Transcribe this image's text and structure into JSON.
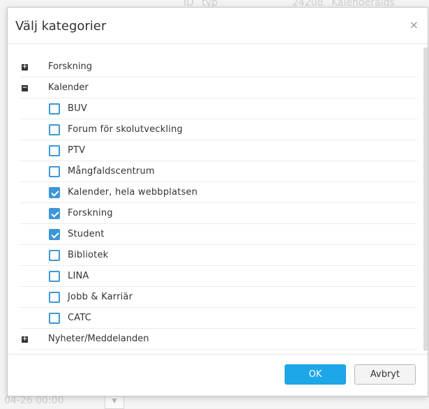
{
  "background": {
    "id_text": "ID _typ",
    "right_text": "24208 _Kalenderalds",
    "date_text": "04-26 00:00",
    "dropdown_icon": "chevron-down-icon"
  },
  "dialog": {
    "title": "Välj kategorier",
    "close_label": "×",
    "categories": [
      {
        "label": "Forskning",
        "expander": "+",
        "children": []
      },
      {
        "label": "Kalender",
        "expander": "−",
        "children": [
          {
            "label": "BUV",
            "checked": false
          },
          {
            "label": "Forum för skolutveckling",
            "checked": false
          },
          {
            "label": "PTV",
            "checked": false
          },
          {
            "label": "Mångfaldscentrum",
            "checked": false
          },
          {
            "label": "Kalender, hela webbplatsen",
            "checked": true
          },
          {
            "label": "Forskning",
            "checked": true
          },
          {
            "label": "Student",
            "checked": true
          },
          {
            "label": "Bibliotek",
            "checked": false
          },
          {
            "label": "LINA",
            "checked": false
          },
          {
            "label": "Jobb & Karriär",
            "checked": false
          },
          {
            "label": "CATC",
            "checked": false
          }
        ]
      },
      {
        "label": "Nyheter/Meddelanden",
        "expander": "+",
        "children": []
      }
    ],
    "ok_label": "OK",
    "cancel_label": "Avbryt"
  },
  "colors": {
    "accent": "#3c97d8",
    "ok_button": "#1ea7e8"
  }
}
